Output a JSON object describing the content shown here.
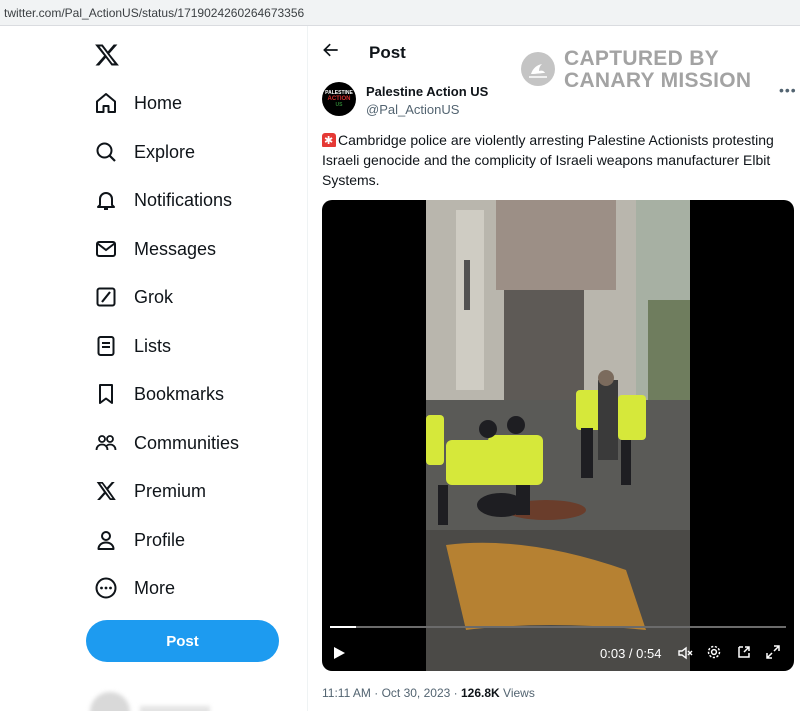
{
  "browser": {
    "url": "twitter.com/Pal_ActionUS/status/1719024260264673356"
  },
  "sidebar": {
    "logo_icon": "x-logo-icon",
    "items": [
      {
        "label": "Home",
        "icon": "home-icon"
      },
      {
        "label": "Explore",
        "icon": "search-icon"
      },
      {
        "label": "Notifications",
        "icon": "bell-icon"
      },
      {
        "label": "Messages",
        "icon": "envelope-icon"
      },
      {
        "label": "Grok",
        "icon": "grok-icon"
      },
      {
        "label": "Lists",
        "icon": "list-icon"
      },
      {
        "label": "Bookmarks",
        "icon": "bookmark-icon"
      },
      {
        "label": "Communities",
        "icon": "people-icon"
      },
      {
        "label": "Premium",
        "icon": "x-logo-icon"
      },
      {
        "label": "Profile",
        "icon": "person-icon"
      },
      {
        "label": "More",
        "icon": "more-circle-icon"
      }
    ],
    "post_button": "Post"
  },
  "header": {
    "title": "Post"
  },
  "watermark": {
    "line1": "CAPTURED BY",
    "line2": "CANARY MISSION"
  },
  "tweet": {
    "author": {
      "name": "Palestine Action US",
      "handle": "@Pal_ActionUS",
      "avatar_lines": [
        "PALESTINE",
        "ACTION",
        "US"
      ]
    },
    "text": "Cambridge police are violently arresting Palestine Actionists protesting Israeli genocide and the complicity of Israeli weapons manufacturer Elbit Systems.",
    "video": {
      "current_time": "0:03",
      "duration": "0:54",
      "time_display": "0:03 / 0:54",
      "progress_fraction": 0.056
    },
    "timestamp": "11:11 AM · Oct 30, 2023",
    "views_count": "126.8K",
    "views_label": "Views"
  },
  "colors": {
    "accent": "#1d9bf0",
    "text": "#0f1419",
    "muted": "#536471"
  }
}
